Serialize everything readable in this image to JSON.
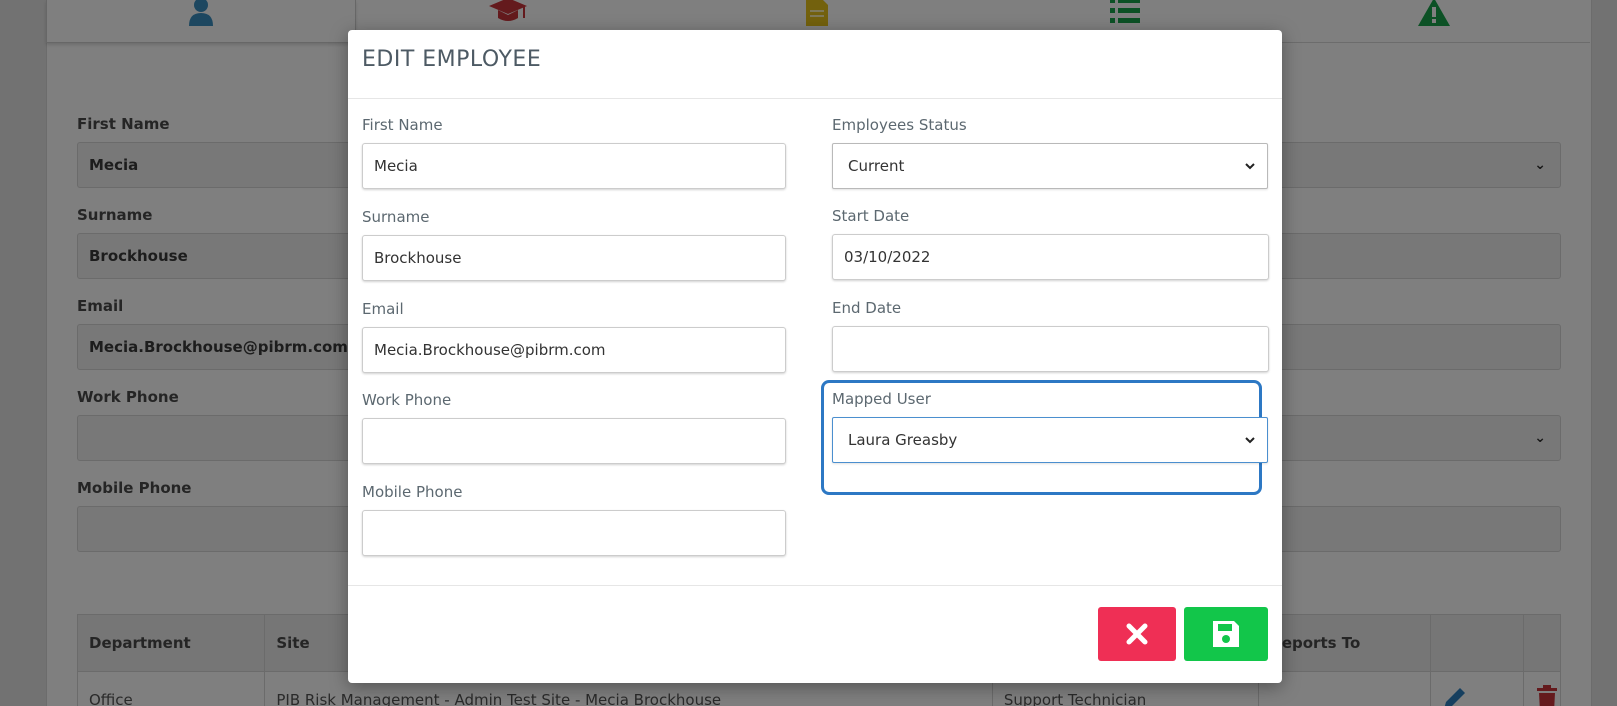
{
  "background": {
    "tabs": [
      {
        "icon": "user-icon",
        "color": "#3b8fc0"
      },
      {
        "icon": "graduation-cap-icon",
        "color": "#c9343b"
      },
      {
        "icon": "document-icon",
        "color": "#e7c21a"
      },
      {
        "icon": "list-icon",
        "color": "#19a34b"
      },
      {
        "icon": "warning-icon",
        "color": "#19a34b"
      }
    ],
    "fields": {
      "first_name_label": "First Name",
      "first_name_value": "Mecia",
      "surname_label": "Surname",
      "surname_value": "Brockhouse",
      "email_label": "Email",
      "email_value": "Mecia.Brockhouse@pibrm.com",
      "work_phone_label": "Work Phone",
      "mobile_phone_label": "Mobile Phone"
    },
    "table": {
      "headers": [
        "Department",
        "Site",
        "Reports To"
      ],
      "row": {
        "department": "Office",
        "site": "PIB Risk Management - Admin Test Site - Mecia Brockhouse",
        "role": "Support Technician"
      }
    }
  },
  "modal": {
    "title": "EDIT EMPLOYEE",
    "first_name": {
      "label": "First Name",
      "value": "Mecia"
    },
    "surname": {
      "label": "Surname",
      "value": "Brockhouse"
    },
    "email": {
      "label": "Email",
      "value": "Mecia.Brockhouse@pibrm.com"
    },
    "work_phone": {
      "label": "Work Phone",
      "value": ""
    },
    "mobile_phone": {
      "label": "Mobile Phone",
      "value": ""
    },
    "status": {
      "label": "Employees Status",
      "value": "Current"
    },
    "start_date": {
      "label": "Start Date",
      "value": "03/10/2022"
    },
    "end_date": {
      "label": "End Date",
      "value": ""
    },
    "mapped_user": {
      "label": "Mapped User",
      "value": "Laura Greasby"
    },
    "buttons": {
      "cancel_icon": "close-icon",
      "save_icon": "save-icon"
    },
    "colors": {
      "cancel": "#ef2f55",
      "save": "#12c64a",
      "highlight": "#2d78c4"
    }
  }
}
